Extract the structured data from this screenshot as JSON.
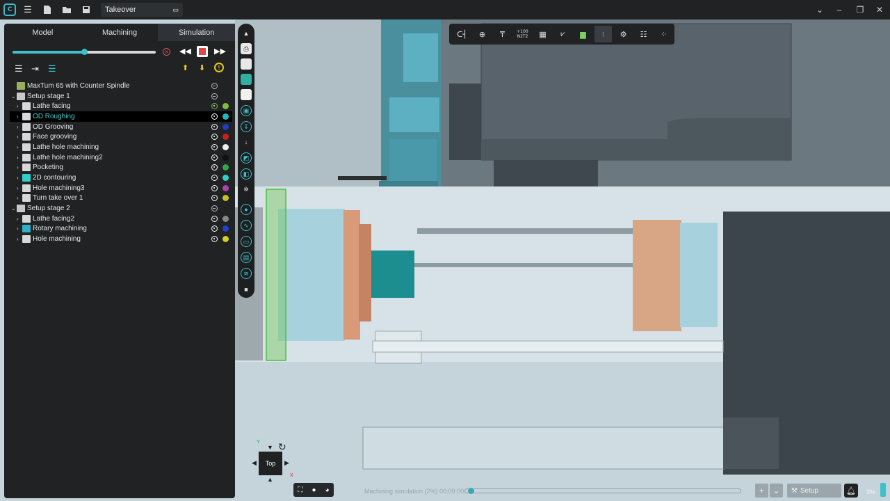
{
  "titlebar": {
    "document_tab": "Takeover",
    "icons": [
      "app-logo-icon",
      "hamburger-icon",
      "new-file-icon",
      "open-folder-icon",
      "save-icon"
    ],
    "window_controls": [
      "chevron-down-icon",
      "minimize-icon",
      "restore-icon",
      "close-icon"
    ]
  },
  "left_panel": {
    "tabs": [
      {
        "label": "Model",
        "active": false
      },
      {
        "label": "Machining",
        "active": false
      },
      {
        "label": "Simulation",
        "active": true
      }
    ],
    "simulation": {
      "speed_fraction": 0.5,
      "controls": [
        "rewind-icon",
        "stop-icon",
        "fast-forward-icon",
        "cancel-icon"
      ],
      "tree_tools": [
        "expand-all-icon",
        "indent-icon",
        "collapse-icon",
        "move-up-icon",
        "move-down-icon",
        "warning-icon"
      ]
    },
    "tree": [
      {
        "label": "MaxTum 65 with Counter Spindle",
        "level": 0,
        "caret": "",
        "icon": "machine-icon",
        "eye": "muted",
        "dot": ""
      },
      {
        "label": "Setup stage 1",
        "level": 0,
        "caret": "v",
        "icon": "setup-icon",
        "eye": "muted",
        "dot": ""
      },
      {
        "label": "Lathe facing",
        "level": 1,
        "caret": ">",
        "icon": "lathe-facing-icon",
        "eye": "tool",
        "dot": "#7fbf3f"
      },
      {
        "label": "OD Roughing",
        "level": 1,
        "caret": ">",
        "icon": "od-roughing-icon",
        "eye": "on",
        "dot": "#1fb8c0",
        "selected": true
      },
      {
        "label": "OD Grooving",
        "level": 1,
        "caret": ">",
        "icon": "od-grooving-icon",
        "eye": "on",
        "dot": "#1d3fc8"
      },
      {
        "label": "Face grooving",
        "level": 1,
        "caret": ">",
        "icon": "face-grooving-icon",
        "eye": "on",
        "dot": "#c82020"
      },
      {
        "label": "Lathe hole machining",
        "level": 1,
        "caret": ">",
        "icon": "hole-icon",
        "eye": "on",
        "dot": "#eeeeee"
      },
      {
        "label": "Lathe hole machining2",
        "level": 1,
        "caret": ">",
        "icon": "hole-icon",
        "eye": "on",
        "dot": "#111111"
      },
      {
        "label": "Pocketing",
        "level": 1,
        "caret": ">",
        "icon": "pocketing-icon",
        "eye": "on",
        "dot": "#2fa84a"
      },
      {
        "label": "2D contouring",
        "level": 1,
        "caret": ">",
        "icon": "contouring-icon",
        "eye": "on",
        "dot": "#2fd0c8"
      },
      {
        "label": "Hole machining3",
        "level": 1,
        "caret": ">",
        "icon": "hole-machining-icon",
        "eye": "on",
        "dot": "#b040b0"
      },
      {
        "label": "Turn take over 1",
        "level": 1,
        "caret": ">",
        "icon": "takeover-icon",
        "eye": "on",
        "dot": "#c8c020"
      },
      {
        "label": "Setup stage 2",
        "level": 0,
        "caret": "v",
        "icon": "setup-icon",
        "eye": "muted",
        "dot": ""
      },
      {
        "label": "Lathe facing2",
        "level": 1,
        "caret": ">",
        "icon": "lathe-facing-icon",
        "eye": "on",
        "dot": "#888888"
      },
      {
        "label": "Rotary machining",
        "level": 1,
        "caret": ">",
        "icon": "rotary-icon",
        "eye": "on",
        "dot": "#2040d0"
      },
      {
        "label": "Hole machining",
        "level": 1,
        "caret": ">",
        "icon": "hole-machining-icon",
        "eye": "on",
        "dot": "#d0d020"
      }
    ]
  },
  "top_toolbar": {
    "buttons": [
      "snap-icon",
      "zoom-region-icon",
      "measure-icon",
      "n2t2-icon",
      "grid-icon",
      "axis-icon",
      "stock-icon",
      "toolpath-icon",
      "settings-icon",
      "list-icon",
      "more-icon"
    ],
    "n2t2_label": "N2T2",
    "n2t2_sup": "+100"
  },
  "view_cube": {
    "face": "Top",
    "y_axis": "Y",
    "x_axis": "X"
  },
  "status": {
    "text": "Machining simulation (2%) 00:00:00",
    "progress": 0.02,
    "zoom_in": "+",
    "zoom_menu": "⌄",
    "setup_label": "Setup",
    "percent": "3%"
  }
}
